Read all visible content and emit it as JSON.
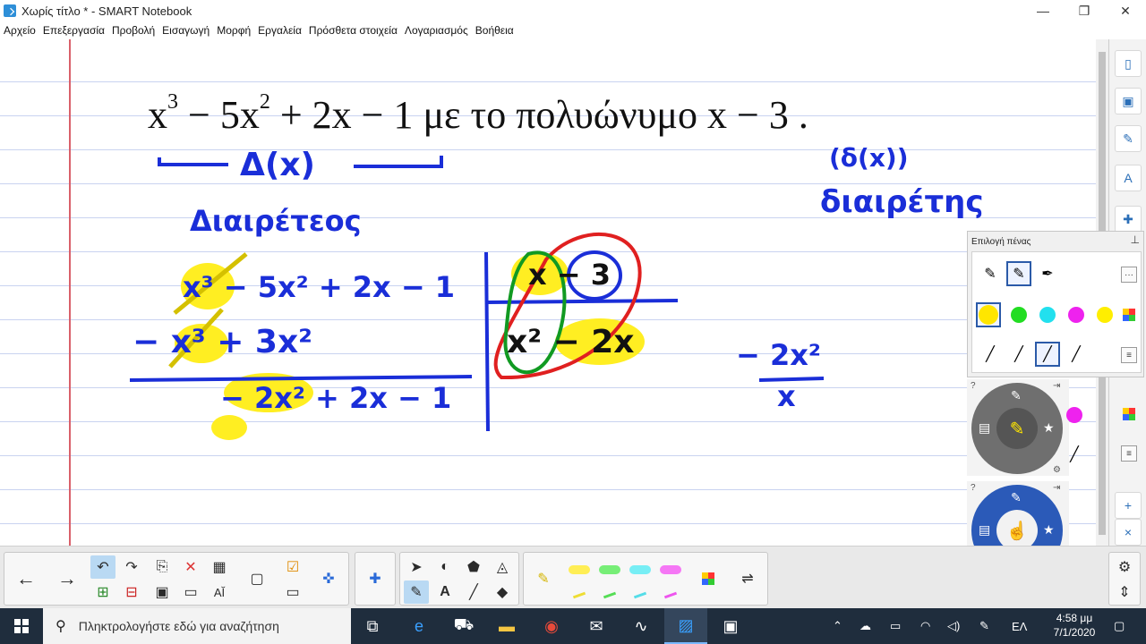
{
  "window": {
    "title": "Χωρίς τίτλο * - SMART Notebook",
    "controls": [
      "minimize",
      "restore",
      "close"
    ]
  },
  "menu": [
    "Αρχείο",
    "Επεξεργασία",
    "Προβολή",
    "Εισαγωγή",
    "Μορφή",
    "Εργαλεία",
    "Πρόσθετα στοιχεία",
    "Λογαριασμός",
    "Βοήθεια"
  ],
  "canvas": {
    "typed_equation": {
      "t1_base": "x",
      "t1_exp": "3",
      "t2": " − 5x",
      "t2_exp": "2",
      "t3": " + 2x − 1",
      "words": "  με το πολυώνυμο  ",
      "divisor": "x − 3 ."
    },
    "handwriting": {
      "dividend_label": "Δ(x)",
      "divisor_label": "(δ(x))",
      "divisor_word": "διαιρέτης",
      "dividend_word": "Διαιρέτεος",
      "row1": "x³ − 5x² + 2x − 1",
      "row2": "− x³ + 3x²",
      "row3": "− 2x² + 2x − 1",
      "divisor_expr": "x − 3",
      "quotient": "x² − 2x",
      "side_num": "− 2x²",
      "side_den": "x"
    }
  },
  "pen_panel": {
    "title": "Επιλογή πένας",
    "colors": [
      "#ffe600",
      "#22dd22",
      "#22e0ee",
      "#ee22ee",
      "#ffee00"
    ],
    "extra_color": "#ee22ee"
  },
  "taskbar": {
    "search_placeholder": "Πληκτρολογήστε εδώ για αναζήτηση",
    "language": "ΕΛ",
    "time": "4:58 μμ",
    "date": "7/1/2020"
  }
}
